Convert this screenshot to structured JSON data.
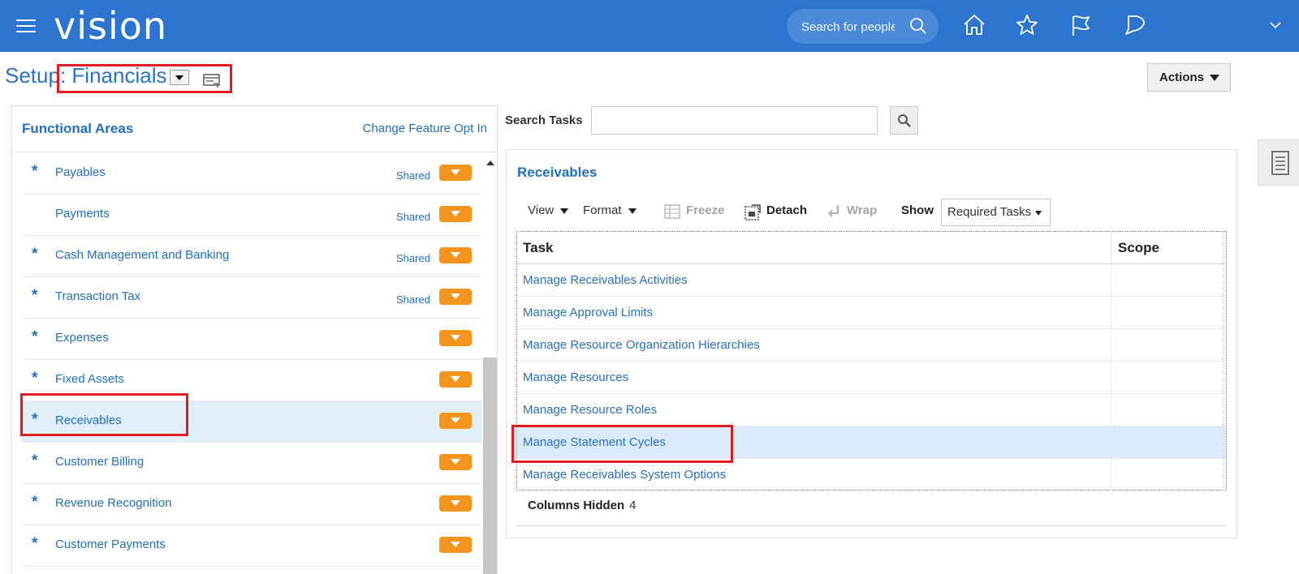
{
  "header": {
    "logo": "vision",
    "search_placeholder": "Search for people"
  },
  "page": {
    "title_prefix": "Setup",
    "title_sep": ":",
    "title_value": "Financials",
    "actions_label": "Actions"
  },
  "functional_areas": {
    "title": "Functional Areas",
    "change_link": "Change Feature Opt In",
    "items": [
      {
        "label": "Payables",
        "required": "*",
        "badge": "Shared"
      },
      {
        "label": "Payments",
        "required": "",
        "badge": "Shared"
      },
      {
        "label": "Cash Management and Banking",
        "required": "*",
        "badge": "Shared"
      },
      {
        "label": "Transaction Tax",
        "required": "*",
        "badge": "Shared"
      },
      {
        "label": "Expenses",
        "required": "*",
        "badge": ""
      },
      {
        "label": "Fixed Assets",
        "required": "*",
        "badge": ""
      },
      {
        "label": "Receivables",
        "required": "*",
        "badge": "",
        "selected": true
      },
      {
        "label": "Customer Billing",
        "required": "*",
        "badge": ""
      },
      {
        "label": "Revenue Recognition",
        "required": "*",
        "badge": ""
      },
      {
        "label": "Customer Payments",
        "required": "*",
        "badge": ""
      }
    ]
  },
  "search_tasks": {
    "label": "Search Tasks",
    "value": ""
  },
  "tasks_panel": {
    "title": "Receivables",
    "toolbar": {
      "view": "View",
      "format": "Format",
      "freeze": "Freeze",
      "detach": "Detach",
      "wrap": "Wrap",
      "show": "Show",
      "show_value": "Required Tasks"
    },
    "columns": [
      "Task",
      "Scope"
    ],
    "rows": [
      "Manage Receivables Activities",
      "Manage Approval Limits",
      "Manage Resource Organization Hierarchies",
      "Manage Resources",
      "Manage Resource Roles",
      "Manage Statement Cycles",
      "Manage Receivables System Options"
    ],
    "selected_row": 5,
    "columns_hidden_label": "Columns Hidden",
    "columns_hidden_count": "4"
  },
  "colors": {
    "header_bg": "#2d74d0",
    "link": "#2270bf",
    "badge_orange": "#f5941e",
    "highlight": "#e01b22",
    "selected_row": "#e1effb"
  }
}
